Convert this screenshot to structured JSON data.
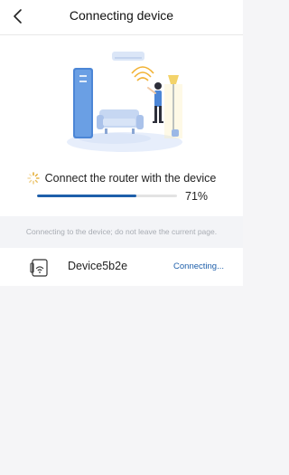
{
  "header": {
    "title": "Connecting device",
    "back_icon": "chevron-left-icon"
  },
  "progress": {
    "status_text": "Connect the router with the device",
    "percent_label": "71%",
    "fraction": 0.71,
    "accent_color": "#1e5faa"
  },
  "hint": {
    "text": "Connecting to the device; do not leave the current page."
  },
  "device": {
    "icon": "router-wifi-icon",
    "name": "Device5b2e",
    "status": "Connecting..."
  }
}
